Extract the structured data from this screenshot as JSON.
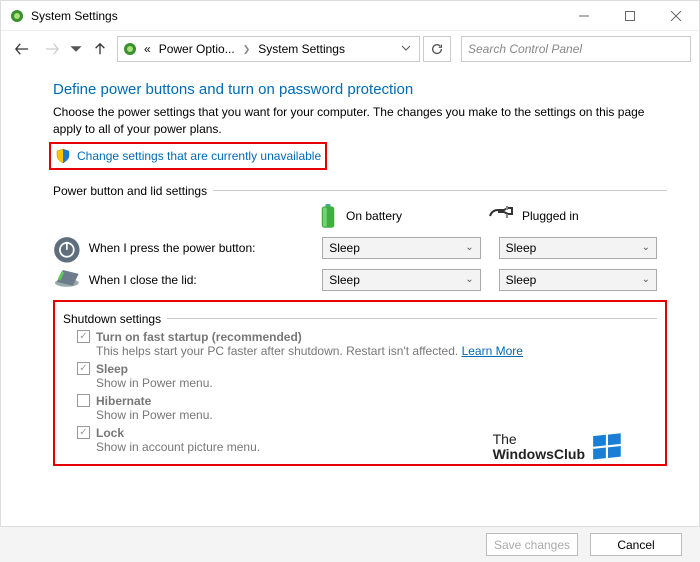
{
  "titlebar": {
    "title": "System Settings"
  },
  "nav": {
    "breadcrumb_prefix": "«",
    "breadcrumb1": "Power Optio...",
    "breadcrumb2": "System Settings"
  },
  "search": {
    "placeholder": "Search Control Panel"
  },
  "page": {
    "heading": "Define power buttons and turn on password protection",
    "description": "Choose the power settings that you want for your computer. The changes you make to the settings on this page apply to all of your power plans.",
    "change_link": "Change settings that are currently unavailable"
  },
  "group1": {
    "label": "Power button and lid settings",
    "battery_label": "On battery",
    "plugged_label": "Plugged in",
    "row_power": "When I press the power button:",
    "row_lid": "When I close the lid:",
    "sel_power_battery": "Sleep",
    "sel_power_plugged": "Sleep",
    "sel_lid_battery": "Sleep",
    "sel_lid_plugged": "Sleep"
  },
  "shutdown": {
    "label": "Shutdown settings",
    "fast_title": "Turn on fast startup (recommended)",
    "fast_sub": "This helps start your PC faster after shutdown. Restart isn't affected. ",
    "learn": "Learn More",
    "sleep_title": "Sleep",
    "sleep_sub": "Show in Power menu.",
    "hibernate_title": "Hibernate",
    "hibernate_sub": "Show in Power menu.",
    "lock_title": "Lock",
    "lock_sub": "Show in account picture menu."
  },
  "footer": {
    "save": "Save changes",
    "cancel": "Cancel"
  },
  "watermark": {
    "line1": "The",
    "line2": "WindowsClub"
  }
}
